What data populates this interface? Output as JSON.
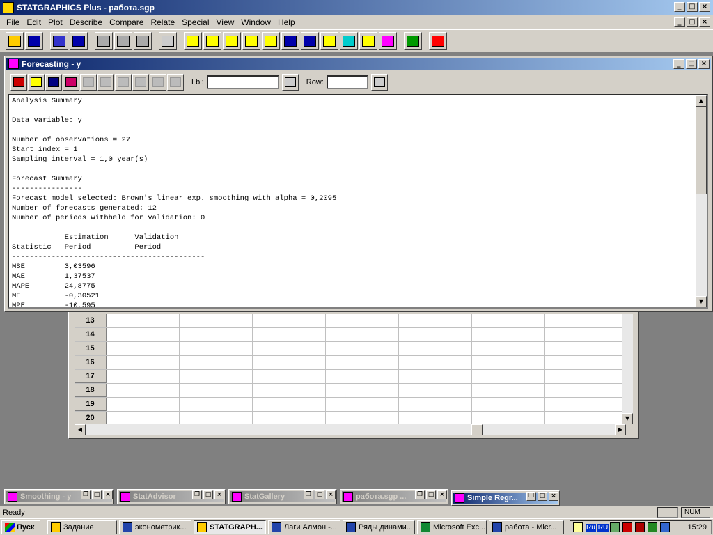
{
  "app": {
    "title": "STATGRAPHICS Plus - работа.sgp"
  },
  "menu": [
    "File",
    "Edit",
    "Plot",
    "Describe",
    "Compare",
    "Relate",
    "Special",
    "View",
    "Window",
    "Help"
  ],
  "toolbar_icons": [
    {
      "name": "open-folder-icon",
      "color": "#ffcc00"
    },
    {
      "name": "save-disk-icon",
      "color": "#0000aa"
    },
    {
      "name": "datasheet-icon",
      "color": "#3333cc"
    },
    {
      "name": "data-disk-icon",
      "color": "#0000aa"
    },
    {
      "name": "cut-icon",
      "color": "#aaaaaa"
    },
    {
      "name": "copy-icon",
      "color": "#aaaaaa"
    },
    {
      "name": "paste-icon",
      "color": "#aaaaaa"
    },
    {
      "name": "print-icon",
      "color": "#cccccc"
    },
    {
      "name": "describe-icon",
      "color": "#ffff00"
    },
    {
      "name": "summary-icon",
      "color": "#ffff00"
    },
    {
      "name": "histogram-icon",
      "color": "#ffff00"
    },
    {
      "name": "xy-icon",
      "color": "#ffff00"
    },
    {
      "name": "scatter-icon",
      "color": "#ffff00"
    },
    {
      "name": "timeseries-icon",
      "color": "#0000aa"
    },
    {
      "name": "distribution-icon",
      "color": "#0000aa"
    },
    {
      "name": "regression-icon",
      "color": "#ffff00"
    },
    {
      "name": "globe-icon",
      "color": "#00cccc"
    },
    {
      "name": "control-chart-icon",
      "color": "#ffff00"
    },
    {
      "name": "statgallery-icon",
      "color": "#ff00ff"
    },
    {
      "name": "statadvisor-icon",
      "color": "#009900"
    },
    {
      "name": "help-icon",
      "color": "#ff0000"
    }
  ],
  "forecast_window": {
    "title": "Forecasting - y",
    "lbl_label": "Lbl:",
    "row_label": "Row:",
    "output_lines": [
      "Analysis Summary",
      "",
      "Data variable: y",
      "",
      "Number of observations = 27",
      "Start index = 1",
      "Sampling interval = 1,0 year(s)",
      "",
      "Forecast Summary",
      "----------------",
      "Forecast model selected: Brown's linear exp. smoothing with alpha = 0,2095",
      "Number of forecasts generated: 12",
      "Number of periods withheld for validation: 0",
      "",
      "            Estimation      Validation",
      "Statistic   Period          Period",
      "--------------------------------------------",
      "MSE         3,03596",
      "MAE         1,37537",
      "MAPE        24,8775",
      "ME          -0,30521",
      "MPE         -10,595"
    ]
  },
  "sheet_rows": [
    "13",
    "14",
    "15",
    "16",
    "17",
    "18",
    "19",
    "20"
  ],
  "minimized_windows": [
    {
      "title": "Smoothing - y",
      "active": false
    },
    {
      "title": "StatAdvisor",
      "active": false
    },
    {
      "title": "StatGallery",
      "active": false
    },
    {
      "title": "работа.sgp ...",
      "active": false
    },
    {
      "title": "Simple Regr...",
      "active": true
    }
  ],
  "status": {
    "text": "Ready",
    "num": "NUM"
  },
  "taskbar": {
    "start": "Пуск",
    "items": [
      {
        "label": "Задание",
        "active": false,
        "icon_color": "#ffcc00"
      },
      {
        "label": "эконометрик...",
        "active": false,
        "icon_color": "#2244aa"
      },
      {
        "label": "STATGRAPH...",
        "active": true,
        "icon_color": "#ffcc00"
      },
      {
        "label": "Лаги Алмон -...",
        "active": false,
        "icon_color": "#2244aa"
      },
      {
        "label": "Ряды динами...",
        "active": false,
        "icon_color": "#2244aa"
      },
      {
        "label": "Microsoft Exc...",
        "active": false,
        "icon_color": "#118833"
      },
      {
        "label": "работа - Micr...",
        "active": false,
        "icon_color": "#2244aa"
      }
    ],
    "tray_lang": [
      "Ru",
      "RU"
    ],
    "clock": "15:29"
  }
}
